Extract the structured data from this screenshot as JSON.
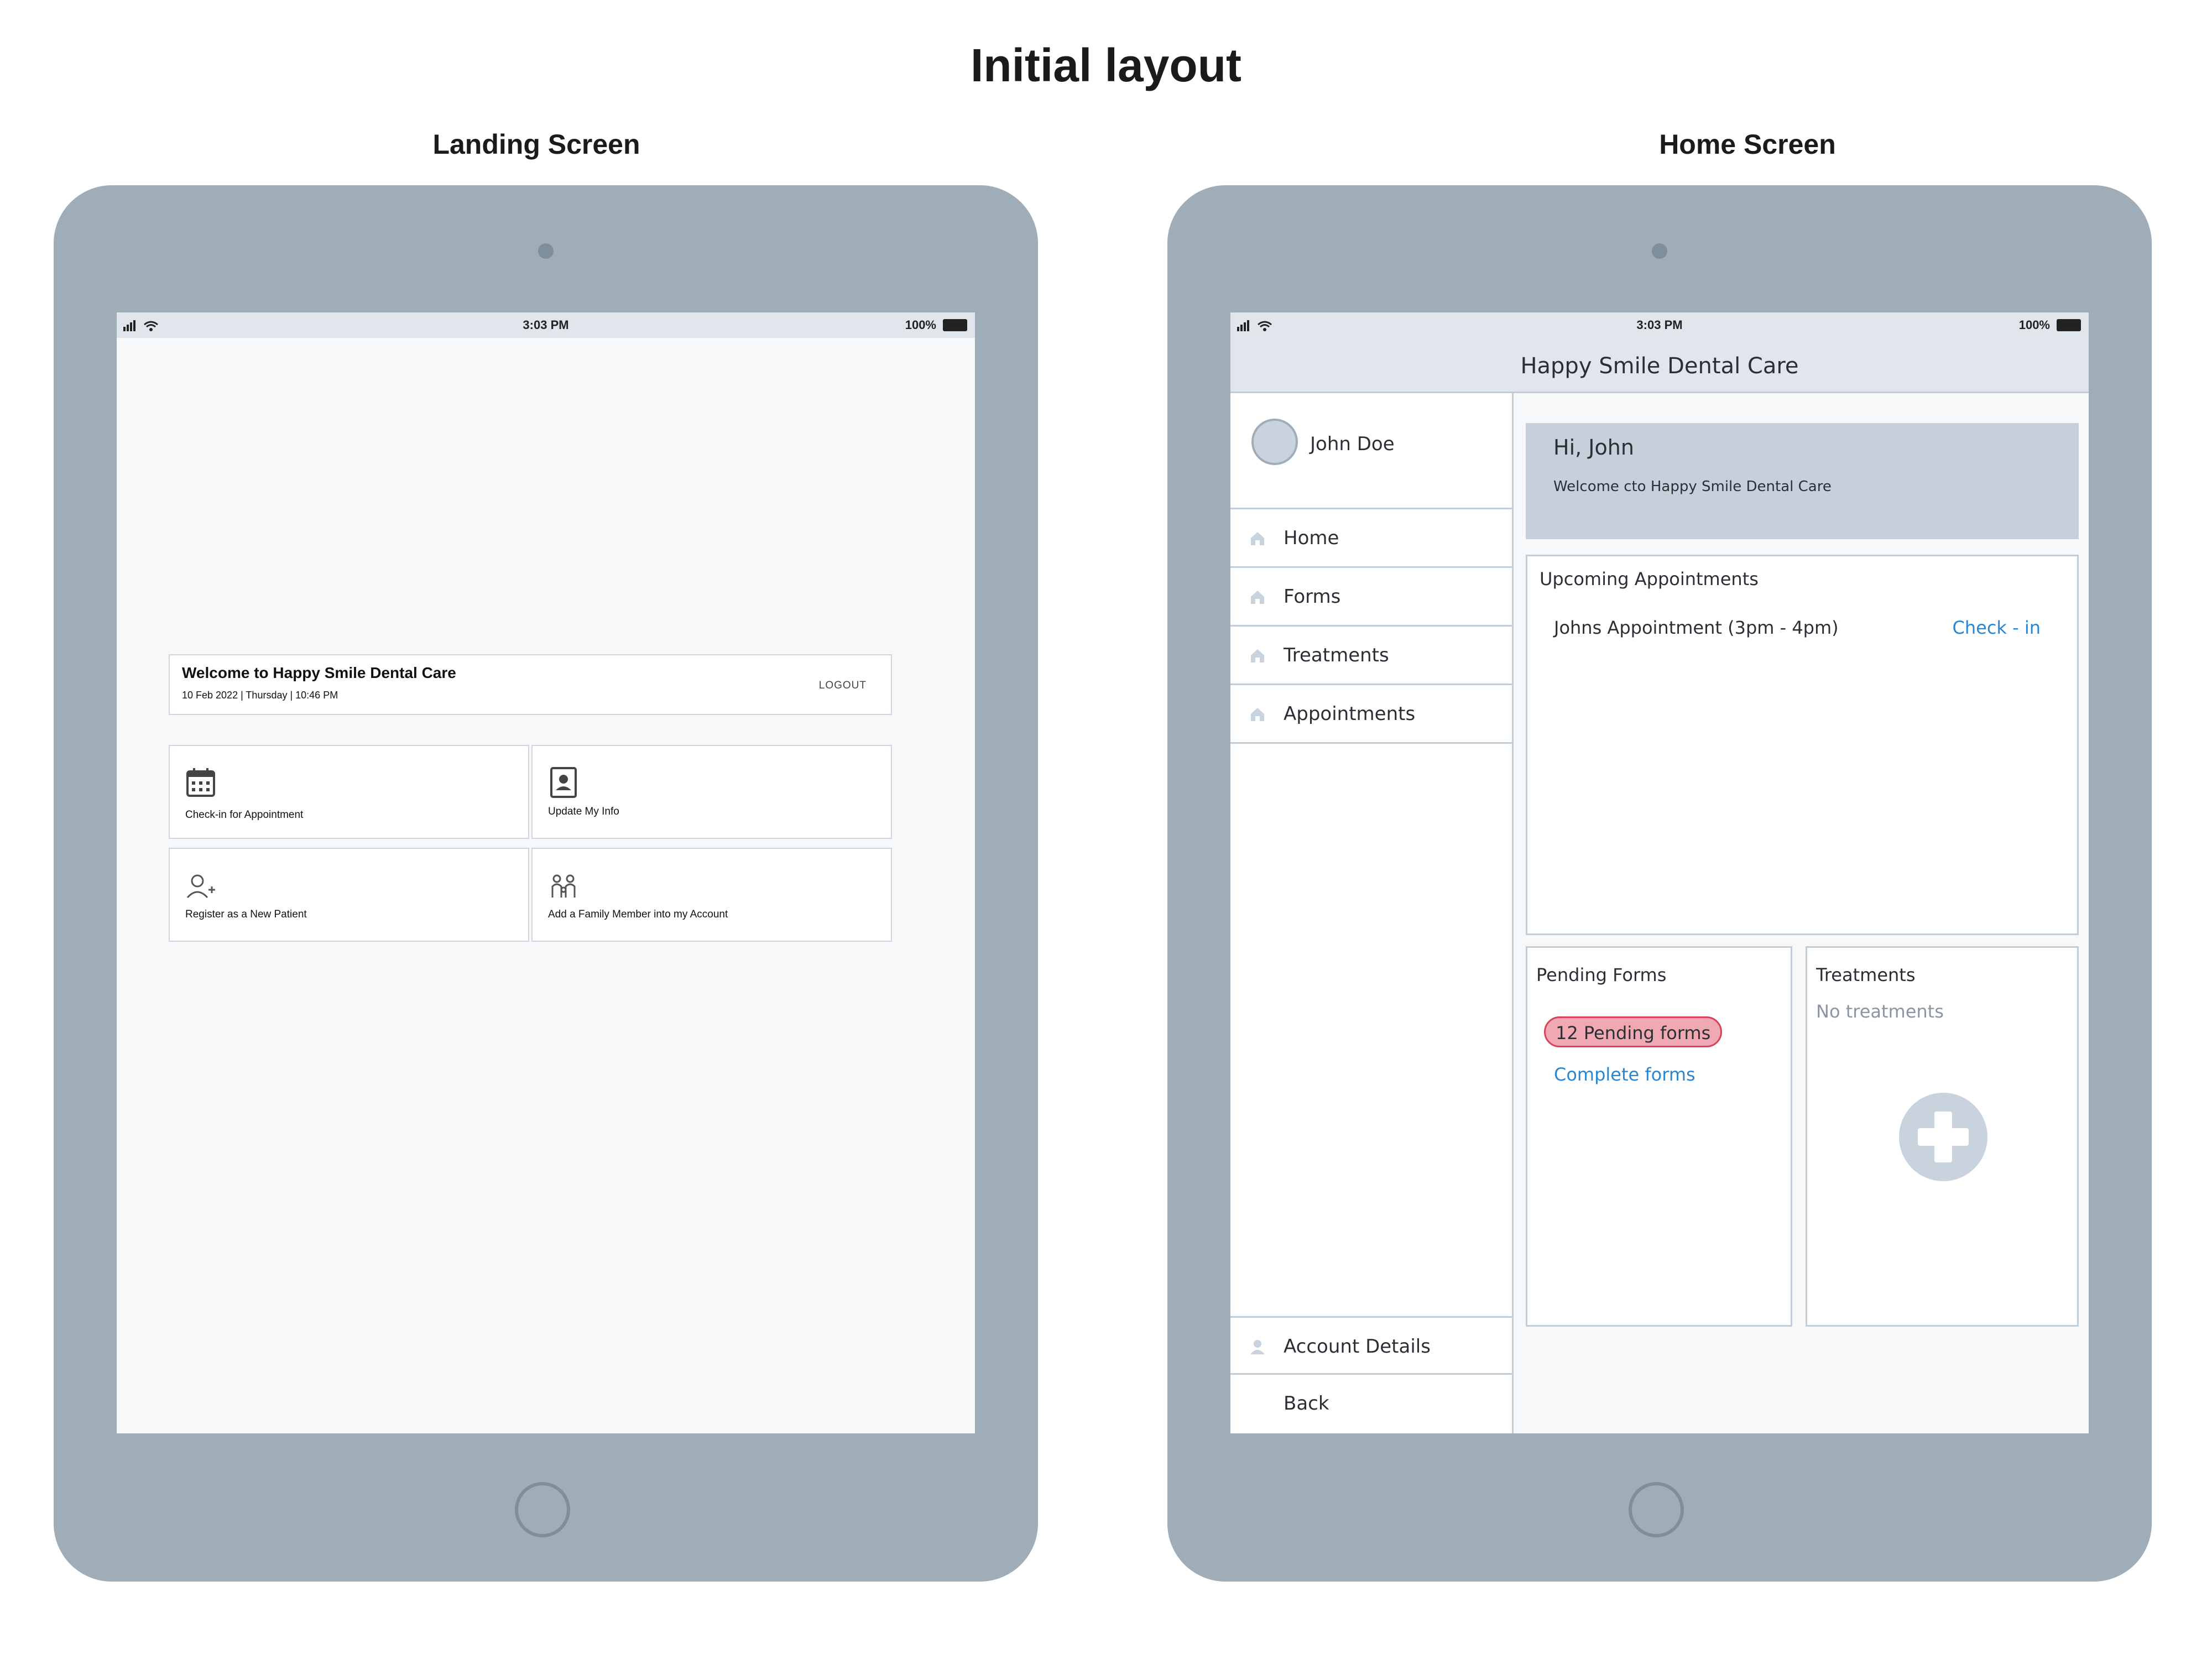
{
  "page": {
    "title": "Initial layout"
  },
  "landing": {
    "heading": "Landing Screen",
    "status": {
      "time": "3:03 PM",
      "battery": "100%"
    },
    "welcome": {
      "title": "Welcome to Happy Smile Dental Care",
      "datetime": "10 Feb 2022 | Thursday | 10:46 PM",
      "logout_label": "LOGOUT"
    },
    "tiles": [
      {
        "label": "Check-in for Appointment",
        "icon": "calendar-icon"
      },
      {
        "label": "Update My Info",
        "icon": "id-badge-icon"
      },
      {
        "label": "Register as a New Patient",
        "icon": "add-user-icon"
      },
      {
        "label": "Add a Family Member into my Account",
        "icon": "family-icon"
      }
    ]
  },
  "home": {
    "heading": "Home Screen",
    "status": {
      "time": "3:03 PM",
      "battery": "100%"
    },
    "header_title": "Happy Smile Dental Care",
    "profile": {
      "name": "John Doe"
    },
    "nav": [
      {
        "label": "Home",
        "icon": "home-icon"
      },
      {
        "label": "Forms",
        "icon": "home-icon"
      },
      {
        "label": "Treatments",
        "icon": "home-icon"
      },
      {
        "label": "Appointments",
        "icon": "home-icon"
      }
    ],
    "nav_bottom": [
      {
        "label": "Account Details",
        "icon": "user-icon"
      },
      {
        "label": "Back"
      }
    ],
    "greeting": {
      "title": "Hi, John",
      "subtitle": "Welcome cto Happy Smile Dental Care"
    },
    "appointments": {
      "title": "Upcoming Appointments",
      "item": "Johns Appointment (3pm - 4pm)",
      "action": "Check - in"
    },
    "forms": {
      "title": "Pending Forms",
      "badge": "12 Pending forms",
      "link": "Complete forms"
    },
    "treatments": {
      "title": "Treatments",
      "empty": "No treatments",
      "icon": "medical-cross-icon"
    }
  },
  "colors": {
    "device": "#9fadb9",
    "screen_bg": "#f7f8fa",
    "header_bg": "#e0e6ec",
    "greeting_bg": "#c5d0da",
    "link": "#2a86d1",
    "badge_bg": "#f0a9b3",
    "badge_border": "#d9425a"
  }
}
